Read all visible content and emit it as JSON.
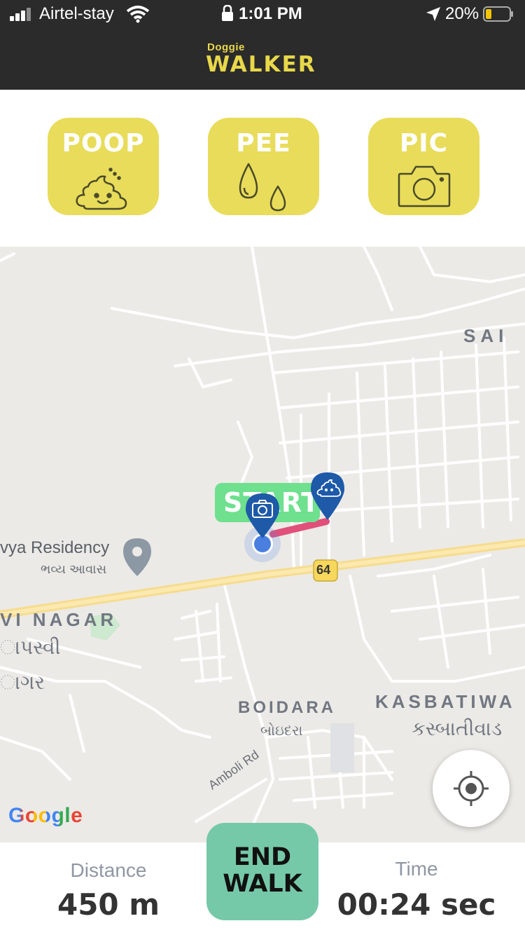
{
  "status_bar": {
    "carrier": "Airtel-stay",
    "time": "1:01 PM",
    "battery": "20%"
  },
  "header": {
    "logo_small": "Doggie",
    "logo_big": "WALKER"
  },
  "actions": {
    "poop": "POOP",
    "pee": "PEE",
    "pic": "PIC"
  },
  "map": {
    "start_label": "START",
    "highway_number": "64",
    "labels": {
      "residency": "vya Residency",
      "residency_gu": "ભવ્ય આવાસ",
      "nagar": "VI NAGAR",
      "nagar_gu_1": "ાપસ્વી",
      "nagar_gu_2": "ાગર",
      "sai": "SAI",
      "boidara": "BOIDARA",
      "boidara_gu": "બોઇદરા",
      "kasbatiwa": "KASBATIWA",
      "kasbatiwa_gu": "કસ્બાતીવાડ",
      "amboli": "Amboli Rd"
    },
    "google": "Google"
  },
  "bottom": {
    "distance_label": "Distance",
    "distance_value": "450 m",
    "end_walk_line1": "END",
    "end_walk_line2": "WALK",
    "time_label": "Time",
    "time_value": "00:24 sec"
  },
  "colors": {
    "header_bg": "#2b2b2b",
    "logo": "#e8d84a",
    "action_button": "#e8dc5a",
    "start_tag": "#6ee08e",
    "end_walk": "#76c9a8",
    "route": "#e0507a",
    "marker": "#1e5aa8"
  }
}
